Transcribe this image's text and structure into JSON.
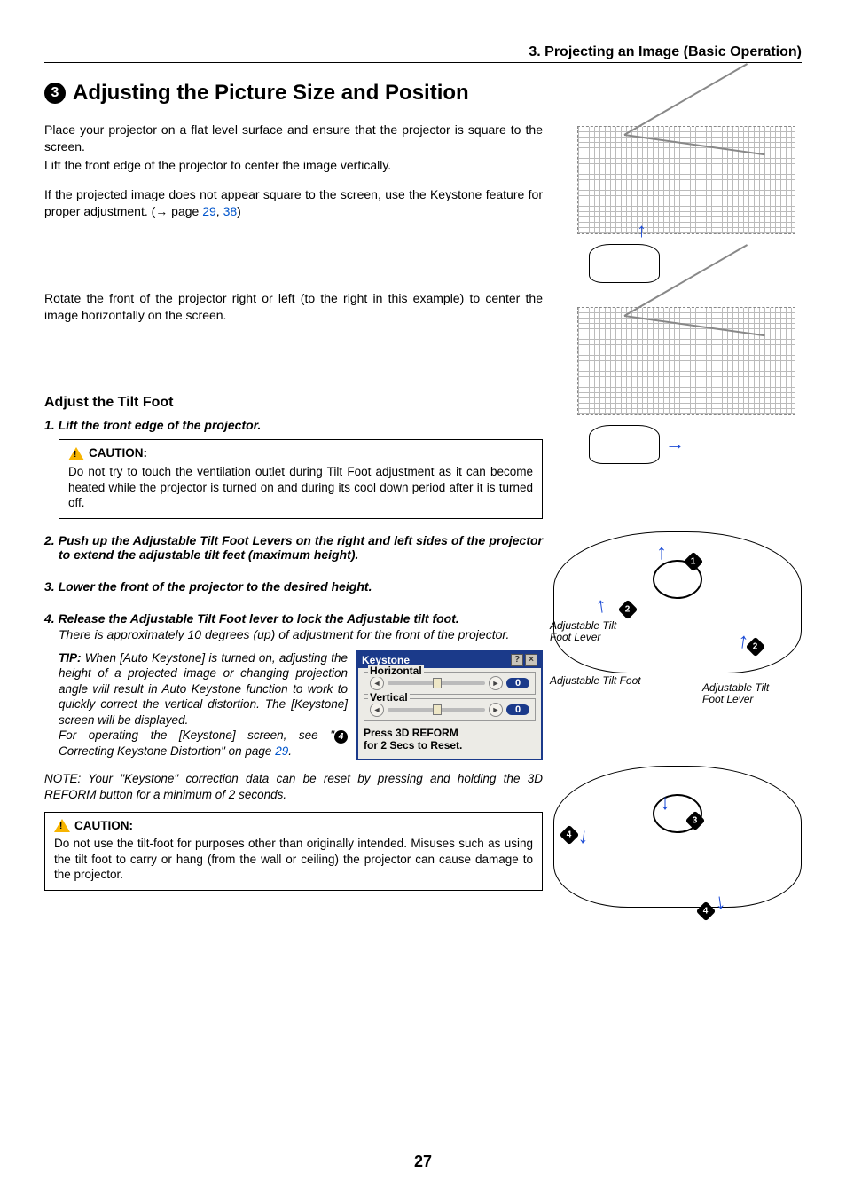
{
  "header": {
    "chapter": "3. Projecting an Image (Basic Operation)"
  },
  "title": {
    "number": "3",
    "text": "Adjusting the Picture Size and Position"
  },
  "intro": {
    "p1": "Place your projector on a flat level surface and ensure that the projector is square to the screen.",
    "p2": "Lift the front edge of the projector to center the image vertically.",
    "p3a": "If the projected image does not appear square to the screen, use the Keystone feature for proper adjustment. (→ page ",
    "link1": "29",
    "comma": ", ",
    "link2": "38",
    "p3b": ")",
    "p4": "Rotate the front of the projector right or left (to the right in this example) to center the image horizontally on the screen."
  },
  "subhead": "Adjust the Tilt Foot",
  "steps": {
    "s1": "1. Lift the front edge of the projector.",
    "caution1_label": "CAUTION:",
    "caution1_body": "Do not try to touch the ventilation outlet during Tilt Foot adjustment as it can become heated while the projector is turned on and during its cool down period after it is turned off.",
    "s2": "2. Push up the Adjustable Tilt Foot Levers on the right and left sides of the projector to extend the adjustable tilt feet (maximum height).",
    "s3": "3. Lower the front of the projector to the desired height.",
    "s4": "4. Release the Adjustable Tilt Foot lever to lock the Adjustable tilt foot.",
    "s4_follow": "There is approximately 10 degrees (up) of adjustment for the front of the projector."
  },
  "tip": {
    "label": "TIP:",
    "body": " When [Auto Keystone] is turned on, adjusting the height of a projected image or changing projection angle will result in Auto Keystone function to work to quickly correct the vertical distortion. The [Keystone] screen will be displayed.",
    "body2a": "For operating the [Keystone] screen, see \"",
    "ref_num": "4",
    "body2b": " Correcting Keystone Distortion\" on page ",
    "ref_page": "29",
    "body2c": "."
  },
  "keystone_panel": {
    "title": "Keystone",
    "h_label": "Horizontal",
    "h_value": "0",
    "v_label": "Vertical",
    "v_value": "0",
    "footer1": "Press 3D REFORM",
    "footer2": "for 2 Secs to Reset."
  },
  "note": "NOTE: Your \"Keystone\" correction data can be reset by pressing and holding the 3D REFORM button for a minimum of 2 seconds.",
  "caution2_label": "CAUTION:",
  "caution2_body": "Do not use the tilt-foot for purposes other than originally intended. Misuses such as using the tilt foot to carry or hang (from the wall or ceiling) the projector can cause damage to the projector.",
  "callouts": {
    "lever1": "Adjustable Tilt Foot Lever",
    "foot": "Adjustable Tilt Foot",
    "lever2": "Adjustable Tilt Foot Lever"
  },
  "page": "27"
}
